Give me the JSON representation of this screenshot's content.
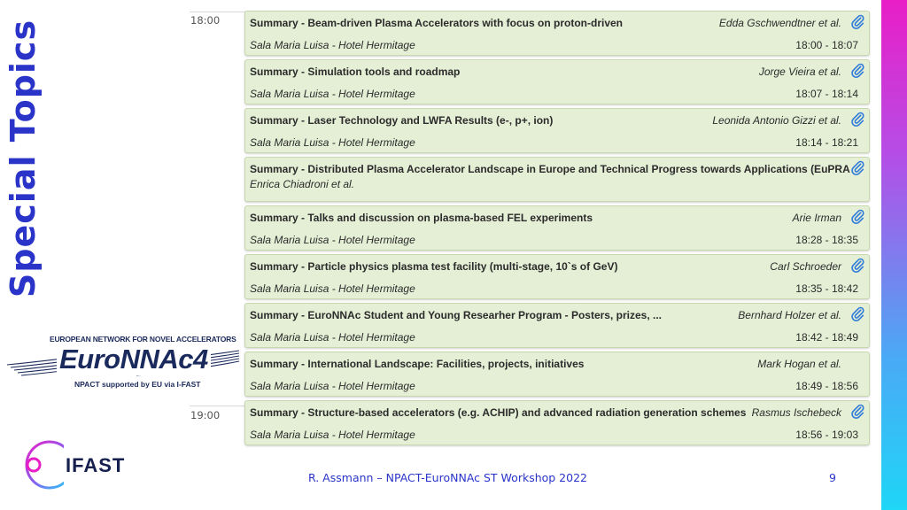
{
  "slide": {
    "side_title": "Special Topics",
    "footer": "R. Assmann – NPACT-EuroNNAc ST Workshop 2022",
    "page_number": "9",
    "accent_color": "#2a34c9"
  },
  "logos": {
    "euronnac": {
      "top_text": "EUROPEAN NETWORK FOR NOVEL ACCELERATORS",
      "wordmark": "EuroNNAc4",
      "bottom_text": "NPACT supported by EU via I-FAST"
    },
    "ifast": {
      "wordmark": "IFAST"
    }
  },
  "timetable": {
    "time_labels": [
      "18:00",
      "19:00"
    ],
    "entries": [
      {
        "title": "Summary - Beam-driven Plasma Accelerators with focus on proton-driven",
        "author": "Edda Gschwendtner et al.",
        "room": "Sala Maria Luisa - Hotel Hermitage",
        "time": "18:00 - 18:07"
      },
      {
        "title": "Summary - Simulation tools and roadmap",
        "author": "Jorge Vieira et al.",
        "room": "Sala Maria Luisa - Hotel Hermitage",
        "time": "18:07 - 18:14"
      },
      {
        "title": "Summary - Laser Technology and LWFA Results (e-, p+, ion)",
        "author": "Leonida Antonio Gizzi et al.",
        "room": "Sala Maria Luisa - Hotel Hermitage",
        "time": "18:14 - 18:21"
      },
      {
        "title": "Summary - Distributed Plasma Accelerator Landscape in Europe and Technical Progress towards Applications (EuPRA",
        "author": "",
        "room": "Enrica Chiadroni et al.",
        "time": ""
      },
      {
        "title": "Summary - Talks and discussion on plasma-based FEL experiments",
        "author": "Arie Irman",
        "room": "Sala Maria Luisa - Hotel Hermitage",
        "time": "18:28 - 18:35"
      },
      {
        "title": "Summary - Particle physics plasma test facility (multi-stage, 10`s of GeV)",
        "author": "Carl Schroeder",
        "room": "Sala Maria Luisa - Hotel Hermitage",
        "time": "18:35 - 18:42"
      },
      {
        "title": "Summary - EuroNNAc Student and Young Researher Program - Posters, prizes, ...",
        "author": "Bernhard Holzer et al.",
        "room": "Sala Maria Luisa - Hotel Hermitage",
        "time": "18:42 - 18:49"
      },
      {
        "title": "Summary - International Landscape: Facilities, projects, initiatives",
        "author": "Mark Hogan et al.",
        "room": "Sala Maria Luisa - Hotel Hermitage",
        "time": "18:49 - 18:56"
      },
      {
        "title": "Summary - Structure-based accelerators (e.g. ACHIP) and advanced radiation generation schemes",
        "author": "Rasmus Ischebeck",
        "room": "Sala Maria Luisa - Hotel Hermitage",
        "time": "18:56 - 19:03"
      }
    ],
    "attachment_icon": "paperclip-icon",
    "entry_color": "#e5efd6"
  }
}
